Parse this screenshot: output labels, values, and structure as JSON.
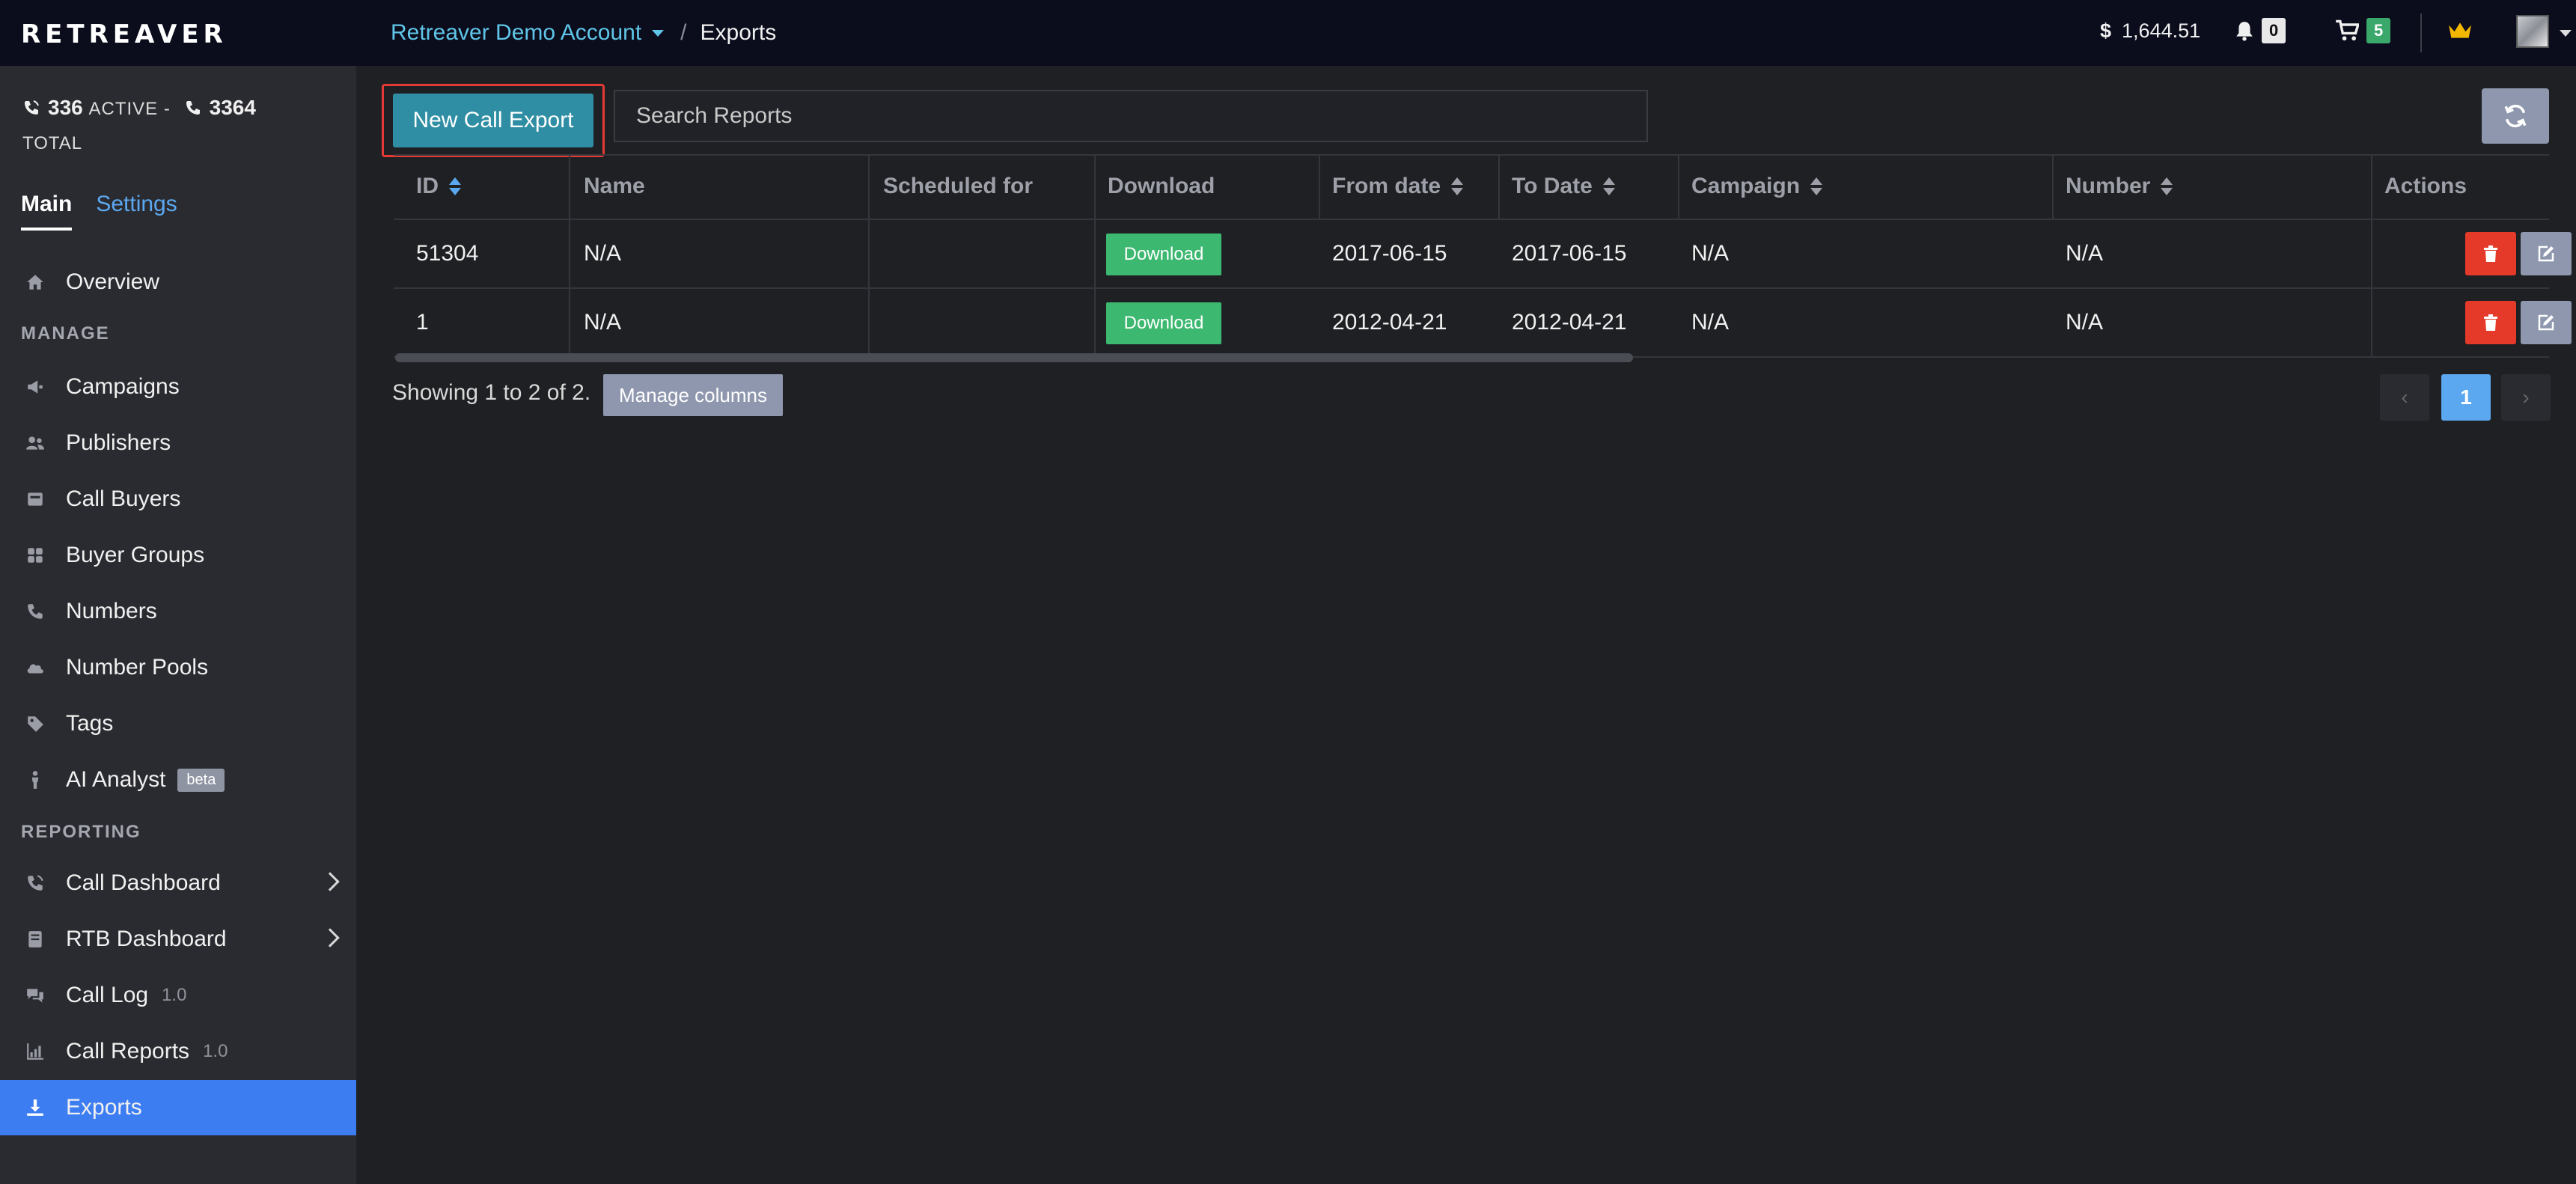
{
  "topbar": {
    "logo": "RETREAVER",
    "account": "Retreaver Demo Account",
    "separator": "/",
    "page": "Exports",
    "balance_currency": "$",
    "balance": "1,644.51",
    "notifications_count": "0",
    "cart_count": "5"
  },
  "sidebar": {
    "active_count": "336",
    "active_label": "ACTIVE -",
    "total_count": "3364",
    "total_label": "TOTAL",
    "tabs": [
      {
        "label": "Main"
      },
      {
        "label": "Settings"
      }
    ],
    "overview": "Overview",
    "manage_heading": "MANAGE",
    "manage_items": [
      {
        "label": "Campaigns",
        "icon": "megaphone-icon"
      },
      {
        "label": "Publishers",
        "icon": "users-icon"
      },
      {
        "label": "Call Buyers",
        "icon": "inbox-icon"
      },
      {
        "label": "Buyer Groups",
        "icon": "grid-icon"
      },
      {
        "label": "Numbers",
        "icon": "phone-icon"
      },
      {
        "label": "Number Pools",
        "icon": "cloud-icon"
      },
      {
        "label": "Tags",
        "icon": "tag-icon"
      },
      {
        "label": "AI Analyst",
        "icon": "person-icon",
        "badge": "beta"
      }
    ],
    "reporting_heading": "REPORTING",
    "reporting_items": [
      {
        "label": "Call Dashboard",
        "icon": "phone-volume-icon"
      },
      {
        "label": "RTB Dashboard",
        "icon": "book-icon"
      },
      {
        "label": "Call Log",
        "icon": "comments-icon",
        "version": "1.0"
      },
      {
        "label": "Call Reports",
        "icon": "bar-chart-icon",
        "version": "1.0"
      },
      {
        "label": "Exports",
        "icon": "download-icon"
      }
    ]
  },
  "toolbar": {
    "new_export_label": "New Call Export",
    "search_placeholder": "Search Reports"
  },
  "table": {
    "headers": [
      "ID",
      "Name",
      "Scheduled for",
      "Download",
      "From date",
      "To Date",
      "Campaign",
      "Number",
      "Actions"
    ],
    "rows": [
      {
        "id": "51304",
        "name": "N/A",
        "scheduled": "",
        "download": "Download",
        "from": "2017-06-15",
        "to": "2017-06-15",
        "campaign": "N/A",
        "number": "N/A"
      },
      {
        "id": "1",
        "name": "N/A",
        "scheduled": "",
        "download": "Download",
        "from": "2012-04-21",
        "to": "2012-04-21",
        "campaign": "N/A",
        "number": "N/A"
      }
    ]
  },
  "footer": {
    "showing": "Showing 1 to 2 of 2.",
    "manage_columns": "Manage columns",
    "page_prev": "‹",
    "current_page": "1",
    "page_next": "›"
  },
  "colors": {
    "accent": "#3d7df2",
    "primary_button": "#2f8ea3",
    "download_button": "#3cb870",
    "delete_button": "#e53a2a",
    "highlight_border": "#e53935"
  }
}
